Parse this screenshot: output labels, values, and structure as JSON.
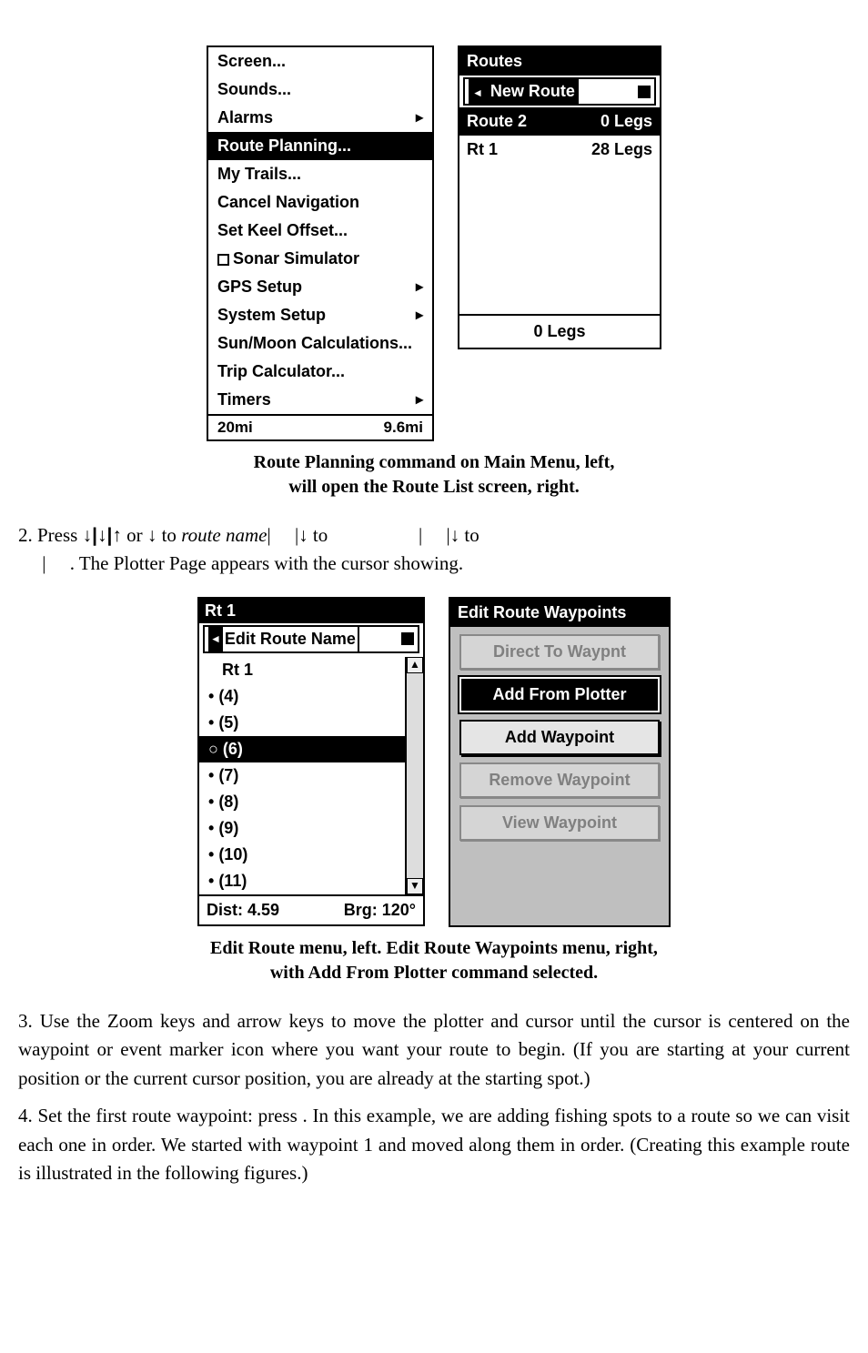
{
  "fig1": {
    "left_menu": {
      "items": [
        {
          "label": "Screen...",
          "submenu": false
        },
        {
          "label": "Sounds...",
          "submenu": false
        },
        {
          "label": "Alarms",
          "submenu": true
        },
        {
          "label": "Route Planning...",
          "submenu": false,
          "selected": true
        },
        {
          "label": "My Trails...",
          "submenu": false
        },
        {
          "label": "Cancel Navigation",
          "submenu": false
        },
        {
          "label": "Set Keel Offset...",
          "submenu": false
        },
        {
          "label": "Sonar Simulator",
          "submenu": false,
          "checkbox": true
        },
        {
          "label": "GPS Setup",
          "submenu": true
        },
        {
          "label": "System Setup",
          "submenu": true
        },
        {
          "label": "Sun/Moon Calculations...",
          "submenu": false
        },
        {
          "label": "Trip Calculator...",
          "submenu": false
        },
        {
          "label": "Timers",
          "submenu": true
        }
      ],
      "status_left": "20mi",
      "status_right": "9.6mi"
    },
    "right_panel": {
      "title": "Routes",
      "rows": [
        {
          "left": "New Route",
          "right": "",
          "selected": true
        },
        {
          "left": "Route 2",
          "right": "0 Legs",
          "inverted": true
        },
        {
          "left": "Rt 1",
          "right": "28 Legs"
        }
      ],
      "footer": "0 Legs"
    },
    "caption_l1": "Route Planning command on Main Menu, left,",
    "caption_l2": "will open the Route List screen, right."
  },
  "step2": {
    "prefix": "2. Press ",
    "keys": "↓|↓|↑",
    "mid1": " or ↓ to ",
    "route_name": "route name",
    "mid2": "|",
    "mid3": "|↓ to",
    "mid4": "|",
    "mid5": "|↓ to",
    "mid6": "|",
    "tail": " . The Plotter Page appears with the cursor showing."
  },
  "fig2": {
    "left_panel": {
      "title": "Rt 1",
      "header": "Edit Route Name",
      "first": "Rt 1",
      "items": [
        {
          "label": "(4)",
          "sel": false
        },
        {
          "label": "(5)",
          "sel": false
        },
        {
          "label": "(6)",
          "sel": true,
          "open": true
        },
        {
          "label": "(7)",
          "sel": false
        },
        {
          "label": "(8)",
          "sel": false
        },
        {
          "label": "(9)",
          "sel": false
        },
        {
          "label": "(10)",
          "sel": false
        },
        {
          "label": "(11)",
          "sel": false
        }
      ],
      "footer_left": "Dist: 4.59",
      "footer_right": "Brg: 120°"
    },
    "right_panel": {
      "title": "Edit Route Waypoints",
      "buttons": [
        {
          "label": "Direct To Waypnt",
          "state": "dis"
        },
        {
          "label": "Add From Plotter",
          "state": "sel"
        },
        {
          "label": "Add Waypoint",
          "state": "normal"
        },
        {
          "label": "Remove Waypoint",
          "state": "dis"
        },
        {
          "label": "View Waypoint",
          "state": "dis"
        }
      ]
    },
    "caption_l1": "Edit Route menu, left. Edit Route Waypoints menu, right,",
    "caption_l2": "with Add From Plotter command selected."
  },
  "step3": "3. Use the Zoom keys and arrow keys to move the plotter and cursor until the cursor is centered on the waypoint or event marker icon where you want your route to begin. (If you are starting at your current position or the current cursor position, you are already at the starting spot.)",
  "step4": "4. Set the first route waypoint: press     . In this example, we are adding fishing spots to a route so we can visit each one in order. We started with waypoint 1 and moved along them in order. (Creating this example route is illustrated in the following figures.)"
}
